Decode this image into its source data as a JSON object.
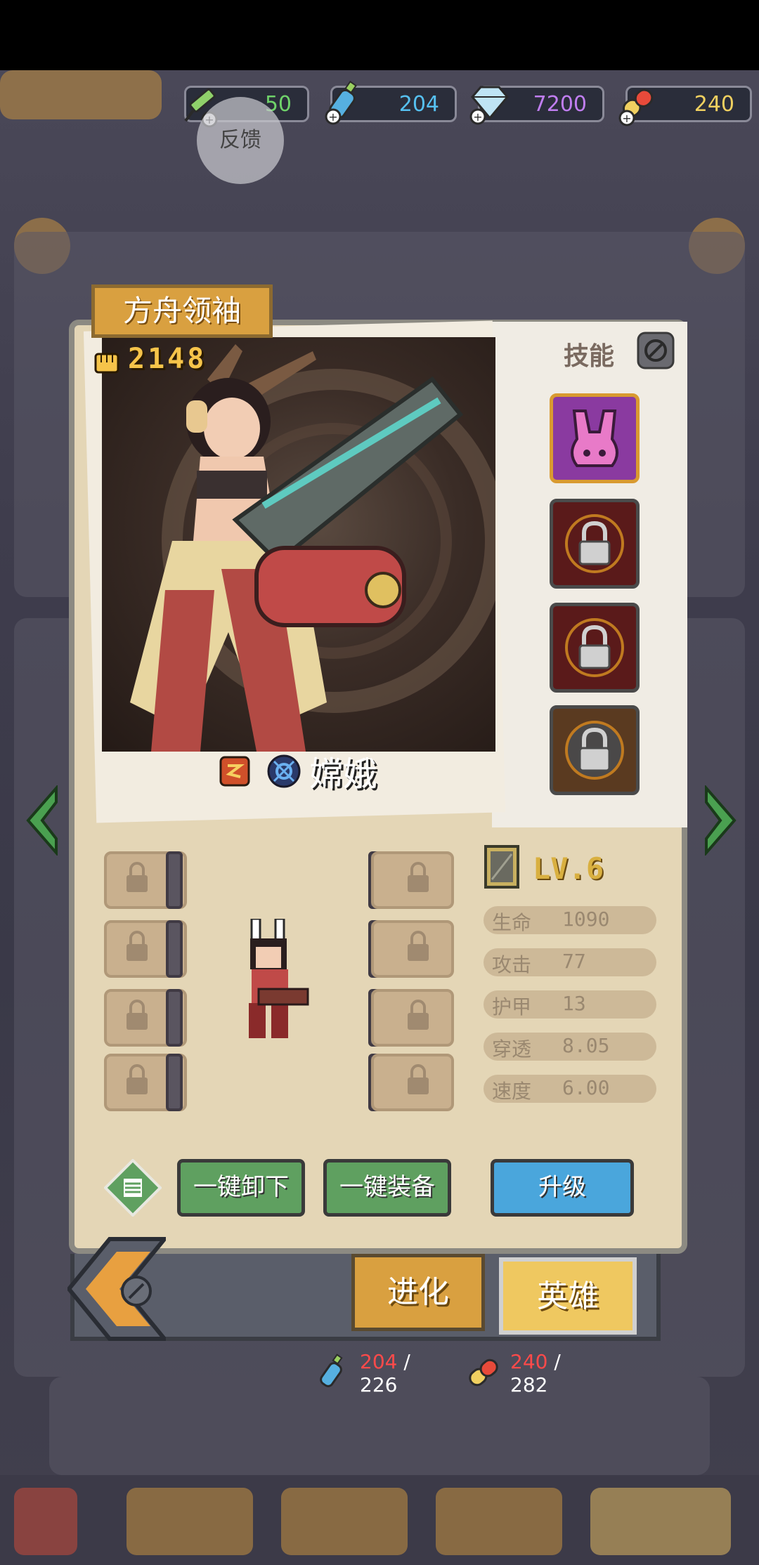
{
  "currencies": [
    {
      "icon": "syringe-icon",
      "value": "50",
      "color": "#6fd26a"
    },
    {
      "icon": "bottle-icon",
      "value": "204",
      "color": "#56c0f0"
    },
    {
      "icon": "diamond-icon",
      "value": "7200",
      "color": "#c07ef0"
    },
    {
      "icon": "capsule-icon",
      "value": "240",
      "color": "#f0d060"
    }
  ],
  "feedback_label": "反馈",
  "hero": {
    "title": "方舟领袖",
    "power": "2148",
    "name": "嫦娥"
  },
  "skills": {
    "title": "技能",
    "slots": [
      {
        "state": "unlocked",
        "icon": "rabbit-skill-icon"
      },
      {
        "state": "locked",
        "icon": "lock-icon"
      },
      {
        "state": "locked",
        "icon": "lock-icon"
      },
      {
        "state": "locked",
        "icon": "lock-icon"
      }
    ]
  },
  "level": "LV.6",
  "stats": [
    {
      "label": "生命",
      "value": "1090"
    },
    {
      "label": "攻击",
      "value": "77"
    },
    {
      "label": "护甲",
      "value": "13"
    },
    {
      "label": "穿透",
      "value": "8.05"
    },
    {
      "label": "速度",
      "value": "6.00"
    }
  ],
  "buttons": {
    "unequip_all": "一键卸下",
    "equip_all": "一键装备",
    "upgrade": "升级"
  },
  "tabs": {
    "evolve": "进化",
    "hero": "英雄"
  },
  "resources": [
    {
      "icon": "bottle-icon",
      "current": "204",
      "required": "226"
    },
    {
      "icon": "capsule-icon",
      "current": "240",
      "required": "282"
    }
  ]
}
